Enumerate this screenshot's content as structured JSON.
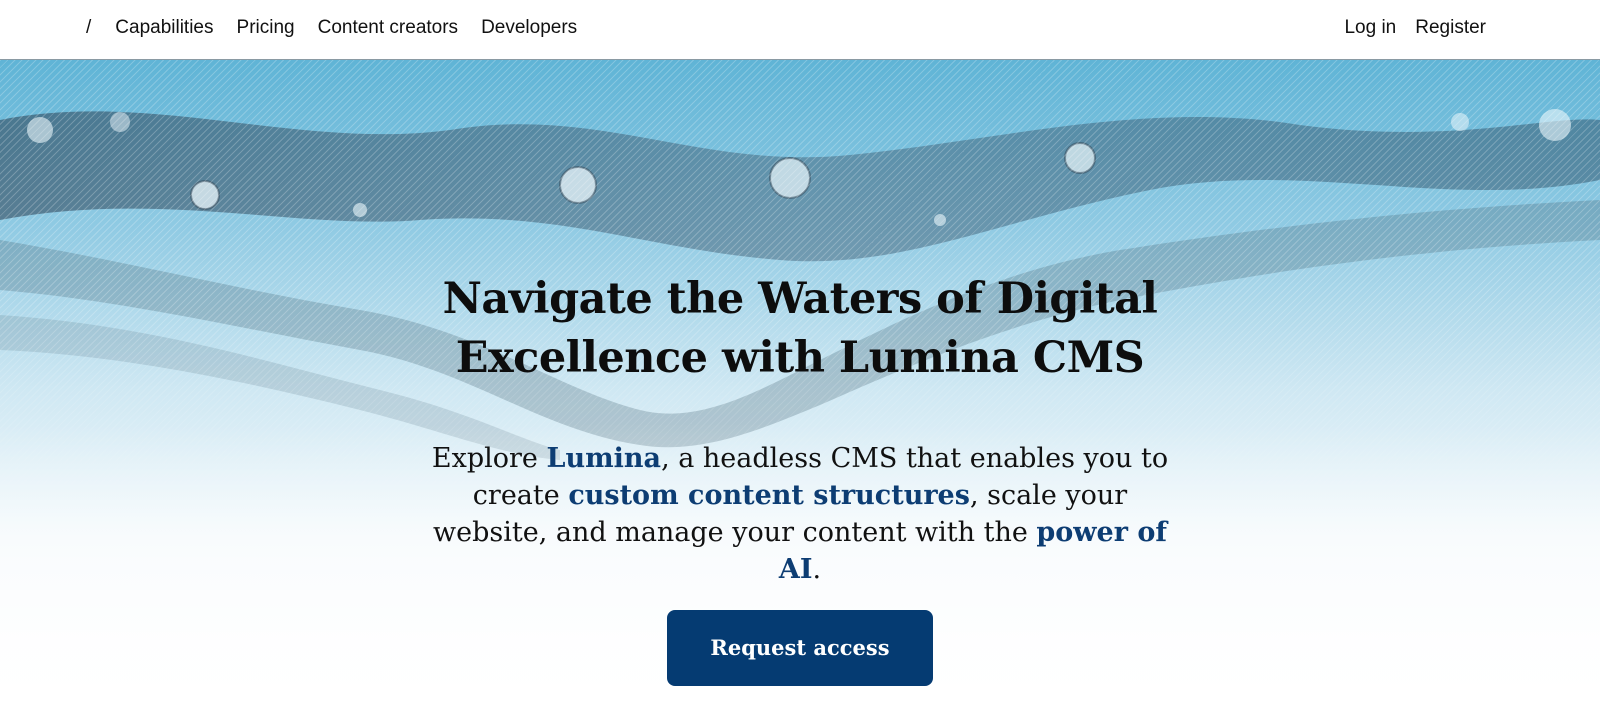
{
  "nav": {
    "home_label": "/",
    "links": [
      "Capabilities",
      "Pricing",
      "Content creators",
      "Developers"
    ],
    "login_label": "Log in",
    "register_label": "Register"
  },
  "hero": {
    "title": "Navigate the Waters of Digital Excellence with Lumina CMS",
    "desc": {
      "p1": "Explore ",
      "h1": "Lumina",
      "p2": ", a headless CMS that enables you to create ",
      "h2": "custom content structures",
      "p3": ", scale your website, and manage your content with the ",
      "h3": "power of AI",
      "p4": "."
    },
    "cta_label": "Request access",
    "background": "water-splash-image"
  },
  "colors": {
    "accent": "#053b72",
    "link_highlight": "#0d3d73",
    "water_blue": "#6fb8d8"
  }
}
